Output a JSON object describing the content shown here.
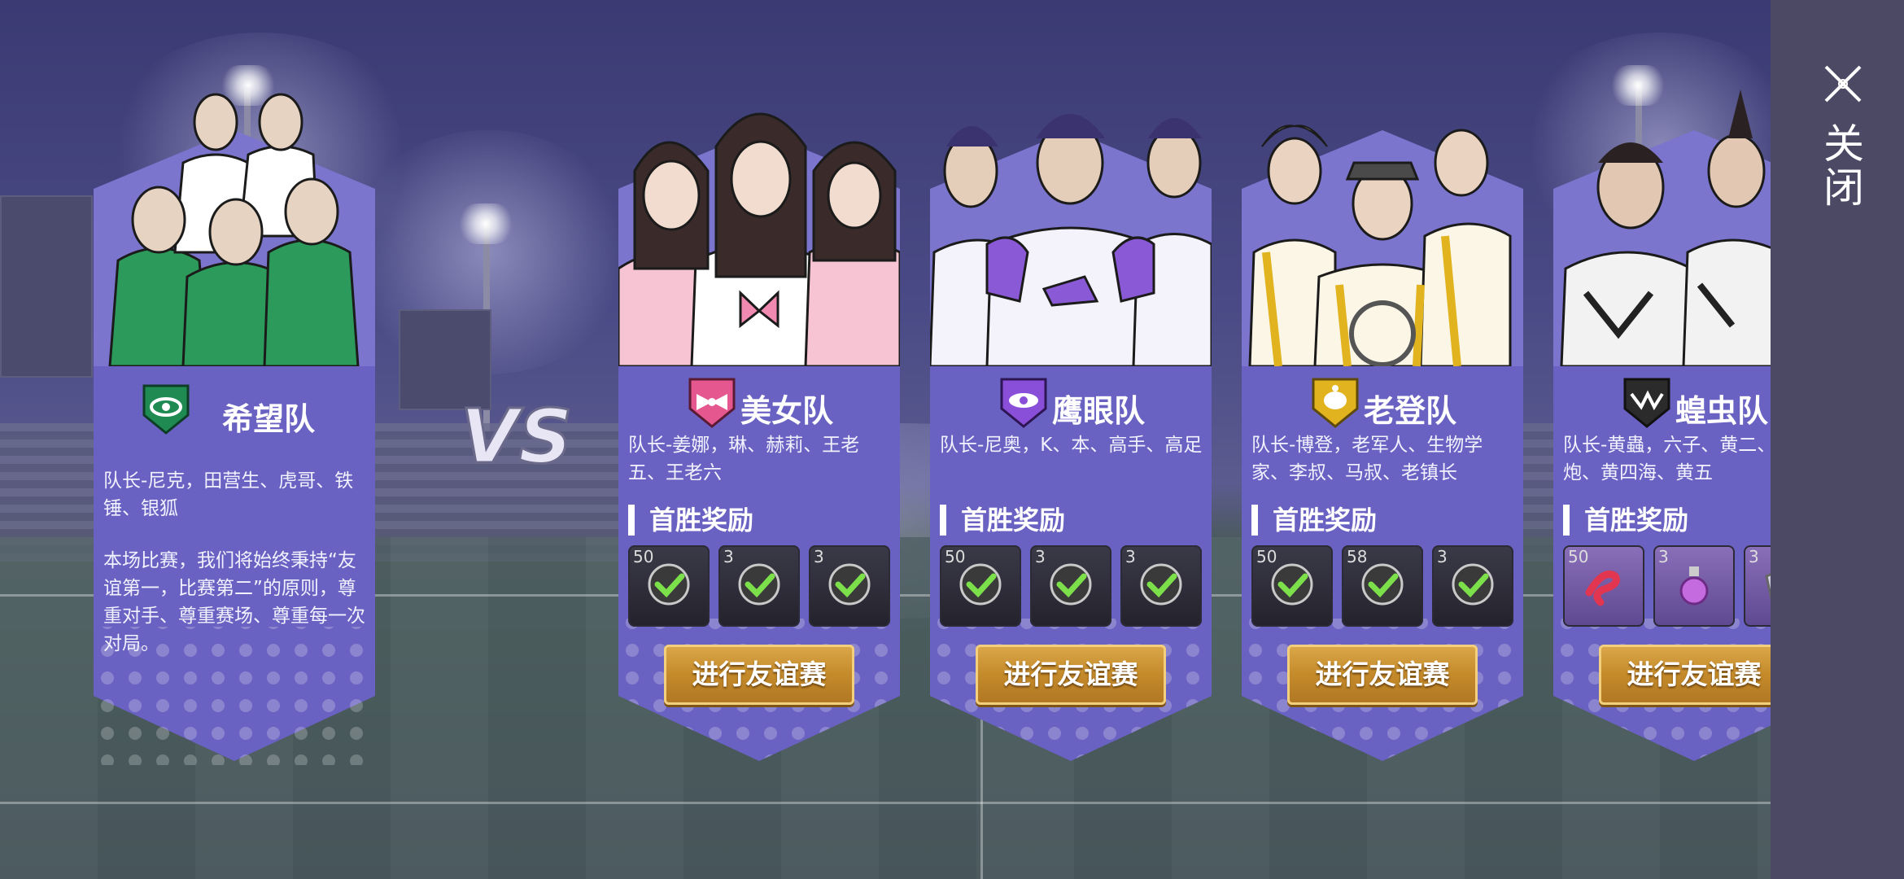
{
  "close": {
    "label": "关闭",
    "icon": "close-x-icon"
  },
  "vs": {
    "text": "VS"
  },
  "home_team": {
    "name": "希望队",
    "emblem": "green-eye-shield-icon",
    "color": "#1f8a52",
    "members": "队长-尼克，田营生、虎哥、铁锤、银狐",
    "intro": "本场比赛，我们将始终秉持“友谊第一，比赛第二”的原则，尊重对手、尊重赛场、尊重每一次对局。"
  },
  "opponents": [
    {
      "name": "美女队",
      "emblem": "pink-bow-shield-icon",
      "color": "#e5578f",
      "members": "队长-姜娜，琳、赫莉、王老五、王老六",
      "reward_title": "首胜奖励",
      "rewards": [
        {
          "qty": "50",
          "icon": "claimed-check-icon"
        },
        {
          "qty": "3",
          "icon": "claimed-check-icon"
        },
        {
          "qty": "3",
          "icon": "claimed-check-icon"
        }
      ],
      "button": "进行友谊赛"
    },
    {
      "name": "鹰眼队",
      "emblem": "purple-eagle-eye-shield-icon",
      "color": "#8a4fd8",
      "members": "队长-尼奥，K、本、高手、高足",
      "reward_title": "首胜奖励",
      "rewards": [
        {
          "qty": "50",
          "icon": "claimed-check-icon"
        },
        {
          "qty": "3",
          "icon": "claimed-check-icon"
        },
        {
          "qty": "3",
          "icon": "claimed-check-icon"
        }
      ],
      "button": "进行友谊赛"
    },
    {
      "name": "老登队",
      "emblem": "yellow-turtle-shield-icon",
      "color": "#e1b31f",
      "members": "队长-博登，老军人、生物学家、李叔、马叔、老镇长",
      "reward_title": "首胜奖励",
      "rewards": [
        {
          "qty": "50",
          "icon": "claimed-check-icon"
        },
        {
          "qty": "58",
          "icon": "claimed-check-icon"
        },
        {
          "qty": "3",
          "icon": "claimed-check-icon"
        }
      ],
      "button": "进行友谊赛"
    },
    {
      "name": "蝗虫队",
      "emblem": "black-locust-shield-icon",
      "color": "#2b2b2b",
      "members": "队长-黄蟲，六子、黄二、黄三炮、黄四海、黄五",
      "reward_title": "首胜奖励",
      "rewards": [
        {
          "qty": "50",
          "icon": "red-ribbon-item-icon"
        },
        {
          "qty": "3",
          "icon": "pink-potion-item-icon"
        },
        {
          "qty": "3",
          "icon": "silver-item-icon"
        }
      ],
      "button": "进行友谊赛"
    }
  ]
}
